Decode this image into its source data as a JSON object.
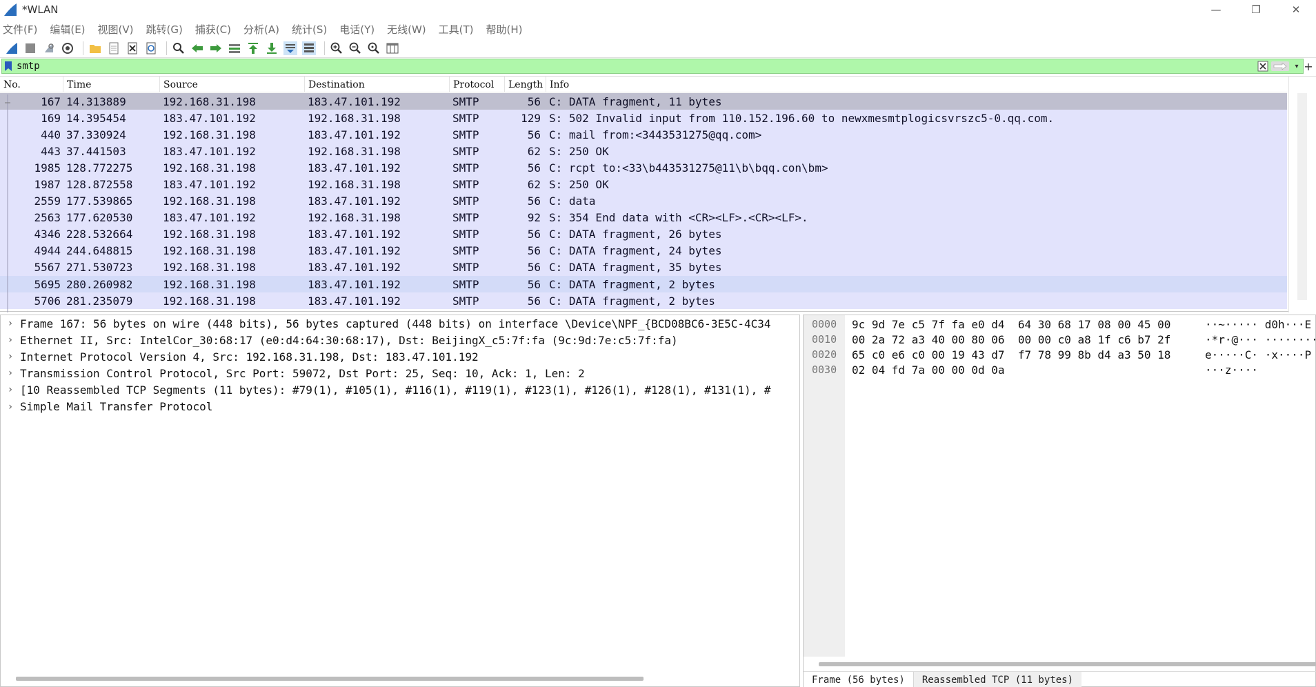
{
  "window": {
    "title": "*WLAN",
    "controls": {
      "minimize": "—",
      "restore": "❐",
      "close": "✕"
    }
  },
  "menu": {
    "items": [
      "文件(F)",
      "编辑(E)",
      "视图(V)",
      "跳转(G)",
      "捕获(C)",
      "分析(A)",
      "统计(S)",
      "电话(Y)",
      "无线(W)",
      "工具(T)",
      "帮助(H)"
    ]
  },
  "filter": {
    "value": "smtp",
    "color": "#aff7aa"
  },
  "packet_list": {
    "columns": [
      "No.",
      "Time",
      "Source",
      "Destination",
      "Protocol",
      "Length",
      "Info"
    ],
    "rows": [
      {
        "no": "167",
        "time": "14.313889",
        "src": "192.168.31.198",
        "dst": "183.47.101.192",
        "proto": "SMTP",
        "len": "56",
        "info": "C: DATA fragment, 11 bytes"
      },
      {
        "no": "169",
        "time": "14.395454",
        "src": "183.47.101.192",
        "dst": "192.168.31.198",
        "proto": "SMTP",
        "len": "129",
        "info": "S: 502 Invalid input from 110.152.196.60 to newxmesmtplogicsvrszc5-0.qq.com."
      },
      {
        "no": "440",
        "time": "37.330924",
        "src": "192.168.31.198",
        "dst": "183.47.101.192",
        "proto": "SMTP",
        "len": "56",
        "info": "C: mail from:<3443531275@qq.com>"
      },
      {
        "no": "443",
        "time": "37.441503",
        "src": "183.47.101.192",
        "dst": "192.168.31.198",
        "proto": "SMTP",
        "len": "62",
        "info": "S: 250 OK"
      },
      {
        "no": "1985",
        "time": "128.772275",
        "src": "192.168.31.198",
        "dst": "183.47.101.192",
        "proto": "SMTP",
        "len": "56",
        "info": "C: rcpt to:<33\\b443531275@11\\b\\bqq.con\\bm>"
      },
      {
        "no": "1987",
        "time": "128.872558",
        "src": "183.47.101.192",
        "dst": "192.168.31.198",
        "proto": "SMTP",
        "len": "62",
        "info": "S: 250 OK"
      },
      {
        "no": "2559",
        "time": "177.539865",
        "src": "192.168.31.198",
        "dst": "183.47.101.192",
        "proto": "SMTP",
        "len": "56",
        "info": "C: data"
      },
      {
        "no": "2563",
        "time": "177.620530",
        "src": "183.47.101.192",
        "dst": "192.168.31.198",
        "proto": "SMTP",
        "len": "92",
        "info": "S: 354 End data with <CR><LF>.<CR><LF>."
      },
      {
        "no": "4346",
        "time": "228.532664",
        "src": "192.168.31.198",
        "dst": "183.47.101.192",
        "proto": "SMTP",
        "len": "56",
        "info": "C: DATA fragment, 26 bytes"
      },
      {
        "no": "4944",
        "time": "244.648815",
        "src": "192.168.31.198",
        "dst": "183.47.101.192",
        "proto": "SMTP",
        "len": "56",
        "info": "C: DATA fragment, 24 bytes"
      },
      {
        "no": "5567",
        "time": "271.530723",
        "src": "192.168.31.198",
        "dst": "183.47.101.192",
        "proto": "SMTP",
        "len": "56",
        "info": "C: DATA fragment, 35 bytes"
      },
      {
        "no": "5695",
        "time": "280.260982",
        "src": "192.168.31.198",
        "dst": "183.47.101.192",
        "proto": "SMTP",
        "len": "56",
        "info": "C: DATA fragment, 2 bytes"
      },
      {
        "no": "5706",
        "time": "281.235079",
        "src": "192.168.31.198",
        "dst": "183.47.101.192",
        "proto": "SMTP",
        "len": "56",
        "info": "C: DATA fragment, 2 bytes"
      }
    ],
    "row_color": "#e2e3fc",
    "selected_color": "#bfbfcf"
  },
  "details": {
    "items": [
      "Frame 167: 56 bytes on wire (448 bits), 56 bytes captured (448 bits) on interface \\Device\\NPF_{BCD08BC6-3E5C-4C34",
      "Ethernet II, Src: IntelCor_30:68:17 (e0:d4:64:30:68:17), Dst: BeijingX_c5:7f:fa (9c:9d:7e:c5:7f:fa)",
      "Internet Protocol Version 4, Src: 192.168.31.198, Dst: 183.47.101.192",
      "Transmission Control Protocol, Src Port: 59072, Dst Port: 25, Seq: 10, Ack: 1, Len: 2",
      "[10 Reassembled TCP Segments (11 bytes): #79(1), #105(1), #116(1), #119(1), #123(1), #126(1), #128(1), #131(1), #",
      "Simple Mail Transfer Protocol"
    ]
  },
  "bytes": {
    "offsets": [
      "0000",
      "0010",
      "0020",
      "0030"
    ],
    "hex": [
      "9c 9d 7e c5 7f fa e0 d4  64 30 68 17 08 00 45 00",
      "00 2a 72 a3 40 00 80 06  00 00 c0 a8 1f c6 b7 2f",
      "65 c0 e6 c0 00 19 43 d7  f7 78 99 8b d4 a3 50 18",
      "02 04 fd 7a 00 00 0d 0a"
    ],
    "ascii": [
      "··~····· d0h···E",
      "·*r·@··· ········",
      "e·····C· ·x····P",
      "···z····"
    ],
    "tabs": [
      "Frame (56 bytes)",
      "Reassembled TCP (11 bytes)"
    ]
  }
}
